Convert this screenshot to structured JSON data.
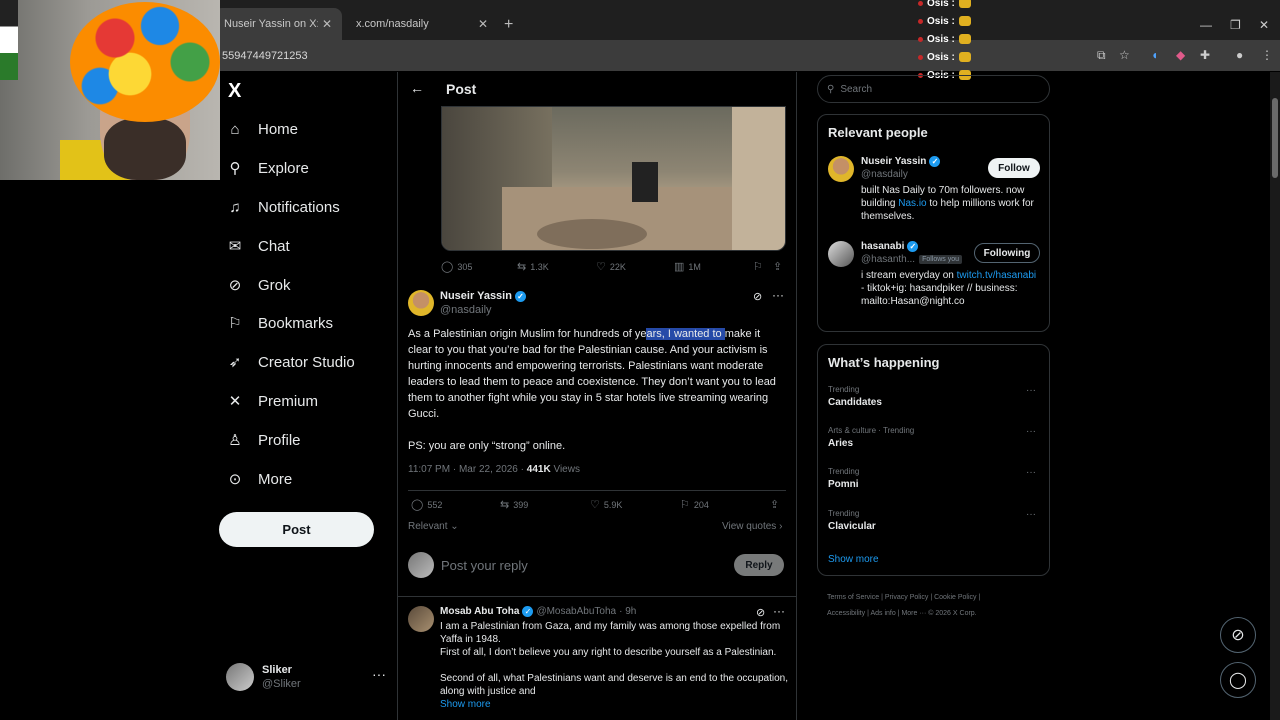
{
  "browser": {
    "tabs": [
      {
        "label": "Nuseir Yassin on X: \"@hasanthehun",
        "close": "✕"
      },
      {
        "label": "x.com/nasdaily",
        "close": "✕"
      }
    ],
    "new_tab": "+",
    "url": "55947449721253",
    "window_controls": [
      "—",
      "❐",
      "✕"
    ]
  },
  "chat_overlay": [
    {
      "user": "Osis :"
    },
    {
      "user": "Osis :"
    },
    {
      "user": "Osis :"
    },
    {
      "user": "Osis :"
    },
    {
      "user": "Osis :"
    }
  ],
  "nav": {
    "logo": "X",
    "items": [
      {
        "label": "Home",
        "icon": "home-icon"
      },
      {
        "label": "Explore",
        "icon": "search-icon"
      },
      {
        "label": "Notifications",
        "icon": "bell-icon"
      },
      {
        "label": "Chat",
        "icon": "mail-icon"
      },
      {
        "label": "Grok",
        "icon": "grok-icon"
      },
      {
        "label": "Bookmarks",
        "icon": "bookmark-icon"
      },
      {
        "label": "Creator Studio",
        "icon": "rocket-icon"
      },
      {
        "label": "Premium",
        "icon": "x-icon"
      },
      {
        "label": "Profile",
        "icon": "person-icon"
      },
      {
        "label": "More",
        "icon": "more-icon"
      }
    ],
    "post_button": "Post",
    "account": {
      "name": "Sliker",
      "handle": "@Sliker",
      "more": "···"
    }
  },
  "main": {
    "title": "Post",
    "quoted_actions": {
      "replies": "305",
      "reposts": "1.3K",
      "likes": "22K",
      "views": "1M"
    },
    "tweet": {
      "name": "Nuseir Yassin",
      "handle": "@nasdaily",
      "body_pre": "As a Palestinian origin Muslim for hundreds of ye",
      "body_highlight": "ars, I wanted to ",
      "body_post": "make it clear to you that you’re bad for the Palestinian cause. And your activism is hurting innocents and empowering terrorists. Palestinians want moderate leaders to lead them to peace and coexistence. They don’t want you to lead them to another fight while you stay in 5 star hotels live streaming wearing Gucci.",
      "body_ps": "PS: you are only “strong” online.",
      "timestamp": "11:07 PM · Mar 22, 2026 · ",
      "views_count": "441K",
      "views_label": " Views",
      "stats": {
        "replies": "552",
        "reposts": "399",
        "likes": "5.9K",
        "bookmarks": "204"
      },
      "sort_label": "Relevant",
      "view_quotes": "View quotes"
    },
    "reply_box": {
      "placeholder": "Post your reply",
      "button": "Reply"
    },
    "reply_tweet": {
      "name": "Mosab Abu Toha",
      "handle": "@MosabAbuToha",
      "time": "· 9h",
      "line1": "I am a Palestinian from Gaza, and my family was among those expelled from Yaffa in 1948.",
      "line2": "First of all, I don’t believe you any right to describe yourself as a Palestinian.",
      "line3": "Second of all, what Palestinians want and deserve is an end to the occupation, along with justice and",
      "show_more": "Show more"
    }
  },
  "right": {
    "search_placeholder": "Search",
    "relevant_title": "Relevant people",
    "people": [
      {
        "name": "Nuseir Yassin",
        "handle": "@nasdaily",
        "bio_pre": "built Nas Daily to 70m followers. now building ",
        "bio_link": "Nas.io",
        "bio_post": " to help millions work for themselves.",
        "button": "Follow"
      },
      {
        "name": "hasanabi",
        "handle": "@hasanth...",
        "follows_you": "Follows you",
        "bio_pre": "i stream everyday on ",
        "bio_link": "twitch.tv/hasanabi",
        "bio_post": " - tiktok+ig: hasandpiker // business: mailto:Hasan@night.co",
        "button": "Following"
      }
    ],
    "happening_title": "What’s happening",
    "trends": [
      {
        "meta": "Trending",
        "title": "Candidates"
      },
      {
        "meta": "Arts & culture · Trending",
        "title": "Aries"
      },
      {
        "meta": "Trending",
        "title": "Pomni"
      },
      {
        "meta": "Trending",
        "title": "Clavicular"
      }
    ],
    "show_more": "Show more",
    "footer": "Terms of Service  |  Privacy Policy  |  Cookie Policy  |\nAccessibility  |  Ads info  |  More ···  © 2026 X Corp."
  }
}
